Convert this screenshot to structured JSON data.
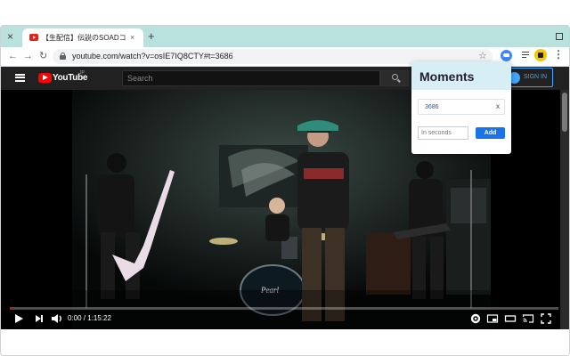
{
  "browser": {
    "tab": {
      "title": "【生配信】伝説のSOADコピー／",
      "close_glyph": "×"
    },
    "newtab_glyph": "+",
    "window_close_glyph": "×",
    "url": "youtube.com/watch?v=osIE7IQ8CTY#t=3686"
  },
  "youtube": {
    "logo_text": "YouTube",
    "country_code": "JP",
    "search_placeholder": "Search",
    "signin_label": "SIGN IN",
    "player": {
      "time_display": "0:00 / 1:15:22",
      "progress_fraction": 0.003
    }
  },
  "moments_popup": {
    "title": "Moments",
    "moments": [
      {
        "value": "3686",
        "delete_glyph": "x"
      }
    ],
    "seconds_placeholder": "In seconds",
    "add_label": "Add"
  },
  "colors": {
    "tabstrip": "#b9e1dd",
    "yt_red": "#ff0000",
    "popup_header": "#d6eef4",
    "add_button": "#1a73e8",
    "moment_text": "#1a4fd8"
  },
  "icons": {
    "back": "arrow-left-icon",
    "forward": "arrow-right-icon",
    "reload": "reload-icon",
    "star": "star-icon",
    "menu": "menu-dots-icon",
    "play": "play-icon",
    "next": "next-icon",
    "volume": "volume-icon",
    "settings": "gear-icon",
    "miniplayer": "miniplayer-icon",
    "theater": "theater-icon",
    "cast": "cast-icon",
    "fullscreen": "fullscreen-icon"
  }
}
